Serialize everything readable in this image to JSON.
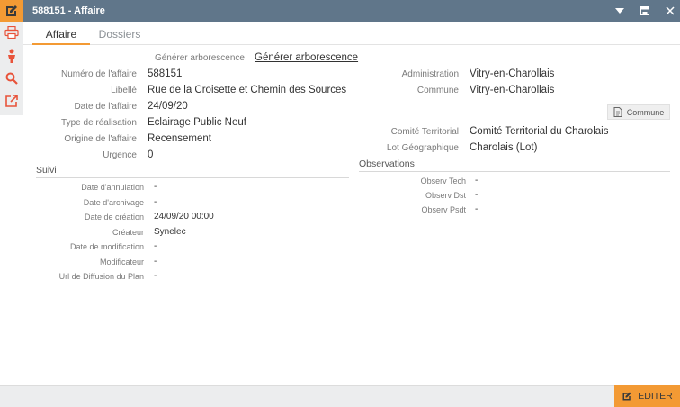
{
  "window": {
    "title": "588151 - Affaire"
  },
  "tabs": [
    {
      "label": "Affaire",
      "active": true
    },
    {
      "label": "Dossiers",
      "active": false
    }
  ],
  "generer": {
    "label": "Générer arborescence",
    "link": "Générer arborescence"
  },
  "left_fields": [
    {
      "label": "Numéro de l'affaire",
      "value": "588151"
    },
    {
      "label": "Libellé",
      "value": "Rue de la Croisette et Chemin des Sources"
    },
    {
      "label": "Date de l'affaire",
      "value": "24/09/20"
    },
    {
      "label": "Type de réalisation",
      "value": "Eclairage Public Neuf"
    },
    {
      "label": "Origine de l'affaire",
      "value": "Recensement"
    },
    {
      "label": "Urgence",
      "value": "0"
    }
  ],
  "right_fields": [
    {
      "label": "Administration",
      "value": "Vitry-en-Charollais"
    },
    {
      "label": "Commune",
      "value": "Vitry-en-Charollais"
    }
  ],
  "commune_button": {
    "label": "Commune"
  },
  "right_fields2": [
    {
      "label": "Comité Territorial",
      "value": "Comité Territorial du Charolais"
    },
    {
      "label": "Lot Géographique",
      "value": "Charolais (Lot)"
    }
  ],
  "suivi": {
    "title": "Suivi",
    "fields": [
      {
        "label": "Date d'annulation",
        "value": "-"
      },
      {
        "label": "Date d'archivage",
        "value": "-"
      },
      {
        "label": "Date de création",
        "value": "24/09/20 00:00"
      },
      {
        "label": "Créateur",
        "value": "Synelec"
      },
      {
        "label": "Date de modification",
        "value": "-"
      },
      {
        "label": "Modificateur",
        "value": "-"
      },
      {
        "label": "Url de Diffusion du Plan",
        "value": "-"
      }
    ]
  },
  "observations": {
    "title": "Observations",
    "fields": [
      {
        "label": "Observ Tech",
        "value": "-"
      },
      {
        "label": "Observ Dst",
        "value": "-"
      },
      {
        "label": "Observ Psdt",
        "value": "-"
      }
    ]
  },
  "footer": {
    "edit_label": "EDITER"
  },
  "colors": {
    "accent": "#f39a34",
    "titlebar": "#60768a",
    "rail_icon": "#e8533a"
  },
  "icons": {
    "logo": "edit-icon",
    "rail": [
      "printer-icon",
      "person-icon",
      "search-icon",
      "external-link-icon"
    ],
    "window": [
      "chevron-down-icon",
      "window-icon",
      "close-icon"
    ]
  }
}
